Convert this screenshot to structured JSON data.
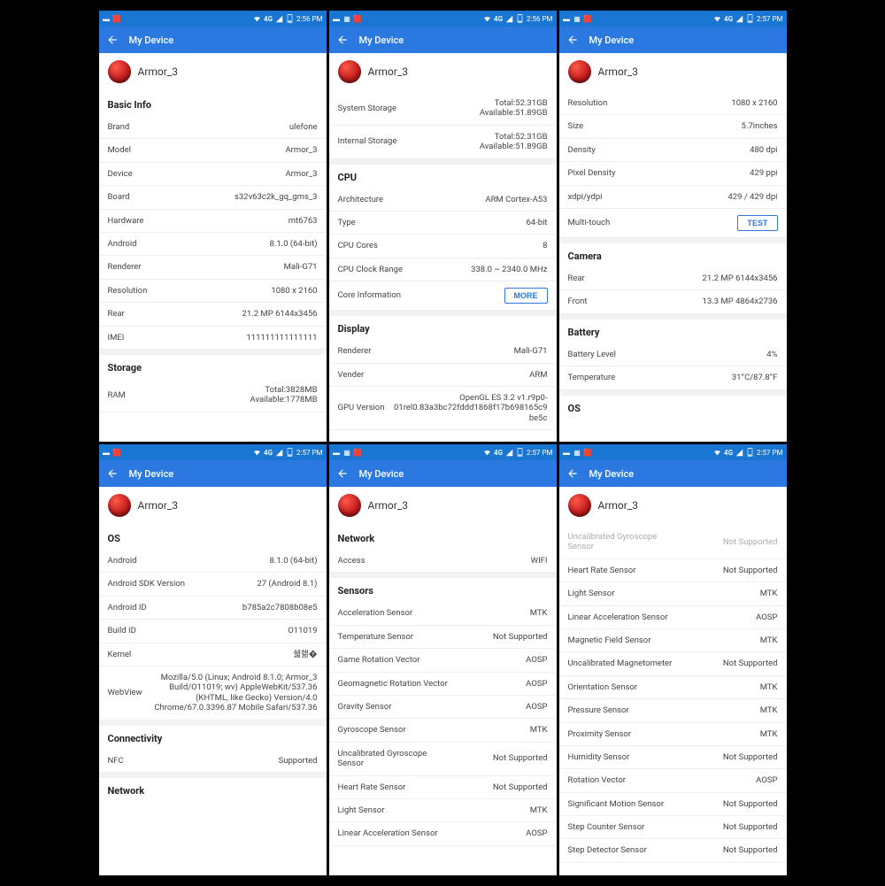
{
  "appbar_title": "My Device",
  "device_name": "Armor_3",
  "screens": [
    {
      "time": "2:56 PM",
      "groups": [
        {
          "title": "Basic Info",
          "rows": [
            {
              "label": "Brand",
              "value": "ulefone"
            },
            {
              "label": "Model",
              "value": "Armor_3"
            },
            {
              "label": "Device",
              "value": "Armor_3"
            },
            {
              "label": "Board",
              "value": "s32v63c2k_gq_gms_3"
            },
            {
              "label": "Hardware",
              "value": "mt6763"
            },
            {
              "label": "Android",
              "value": "8.1.0 (64-bit)"
            },
            {
              "label": "Renderer",
              "value": "Mali-G71"
            },
            {
              "label": "Resolution",
              "value": "1080 x 2160"
            },
            {
              "label": "Rear",
              "value": "21.2 MP 6144x3456"
            },
            {
              "label": "IMEI",
              "value": "111111111111111"
            }
          ]
        },
        {
          "title": "Storage",
          "rows": [
            {
              "label": "RAM",
              "value": "Total:3828MB\nAvailable:1778MB"
            }
          ]
        }
      ]
    },
    {
      "time": "2:56 PM",
      "pre_rows": [
        {
          "label": "System Storage",
          "value": "Total:52.31GB\nAvailable:51.89GB"
        },
        {
          "label": "Internal Storage",
          "value": "Total:52.31GB\nAvailable:51.89GB"
        }
      ],
      "groups": [
        {
          "title": "CPU",
          "rows": [
            {
              "label": "Architecture",
              "value": "ARM Cortex-A53"
            },
            {
              "label": "Type",
              "value": "64-bit"
            },
            {
              "label": "CPU Cores",
              "value": "8"
            },
            {
              "label": "CPU Clock Range",
              "value": "338.0 ~ 2340.0 MHz"
            },
            {
              "label": "Core Information",
              "button": "MORE"
            }
          ]
        },
        {
          "title": "Display",
          "rows": [
            {
              "label": "Renderer",
              "value": "Mali-G71"
            },
            {
              "label": "Vender",
              "value": "ARM"
            },
            {
              "label": "GPU Version",
              "value": "OpenGL ES 3.2 v1.r9p0-01rel0.83a3bc72fddd1868f17b698165c9be5c"
            }
          ]
        }
      ]
    },
    {
      "time": "2:57 PM",
      "pre_rows": [
        {
          "label": "Resolution",
          "value": "1080 x 2160"
        },
        {
          "label": "Size",
          "value": "5.7inches"
        },
        {
          "label": "Density",
          "value": "480 dpi"
        },
        {
          "label": "Pixel Density",
          "value": "429 ppi"
        },
        {
          "label": "xdpi/ydpi",
          "value": "429 / 429 dpi"
        },
        {
          "label": "Multi-touch",
          "button": "TEST"
        }
      ],
      "groups": [
        {
          "title": "Camera",
          "rows": [
            {
              "label": "Rear",
              "value": "21.2 MP 6144x3456"
            },
            {
              "label": "Front",
              "value": "13.3 MP 4864x2736"
            }
          ]
        },
        {
          "title": "Battery",
          "rows": [
            {
              "label": "Battery Level",
              "value": "4%"
            },
            {
              "label": "Temperature",
              "value": "31°C/87.8°F"
            }
          ]
        },
        {
          "title": "OS",
          "rows": []
        }
      ]
    },
    {
      "time": "2:57 PM",
      "groups": [
        {
          "title": "OS",
          "rows": [
            {
              "label": "Android",
              "value": "8.1.0 (64-bit)"
            },
            {
              "label": "Android SDK Version",
              "value": "27 (Android 8.1)"
            },
            {
              "label": "Android ID",
              "value": "b785a2c7808b08e5"
            },
            {
              "label": "Build ID",
              "value": "O11019"
            },
            {
              "label": "Kernel",
              "value": "쉛핾�"
            },
            {
              "label": "WebView",
              "value": "Mozilla/5.0 (Linux; Android 8.1.0; Armor_3 Build/O11019; wv) AppleWebKit/537.36 (KHTML, like Gecko) Version/4.0 Chrome/67.0.3396.87 Mobile Safari/537.36"
            }
          ]
        },
        {
          "title": "Connectivity",
          "rows": [
            {
              "label": "NFC",
              "value": "Supported"
            }
          ]
        },
        {
          "title": "Network",
          "rows": []
        }
      ]
    },
    {
      "time": "2:57 PM",
      "pre_section": "Network",
      "pre_rows_after_title": [
        {
          "label": "Access",
          "value": "WIFI"
        }
      ],
      "groups": [
        {
          "title": "Sensors",
          "rows": [
            {
              "label": "Acceleration Sensor",
              "value": "MTK"
            },
            {
              "label": "Temperature Sensor",
              "value": "Not Supported"
            },
            {
              "label": "Game Rotation Vector",
              "value": "AOSP"
            },
            {
              "label": "Geomagnetic Rotation Vector",
              "value": "AOSP"
            },
            {
              "label": "Gravity Sensor",
              "value": "AOSP"
            },
            {
              "label": "Gyroscope Sensor",
              "value": "MTK"
            },
            {
              "label": "Uncalibrated Gyroscope Sensor",
              "value": "Not Supported"
            },
            {
              "label": "Heart Rate Sensor",
              "value": "Not Supported"
            },
            {
              "label": "Light Sensor",
              "value": "MTK"
            },
            {
              "label": "Linear Acceleration Sensor",
              "value": "AOSP"
            }
          ]
        }
      ]
    },
    {
      "time": "2:57 PM",
      "pre_rows": [
        {
          "label": "Uncalibrated Gyroscope Sensor",
          "value": "Not Supported",
          "faded": true
        },
        {
          "label": "Heart Rate Sensor",
          "value": "Not Supported"
        },
        {
          "label": "Light Sensor",
          "value": "MTK"
        },
        {
          "label": "Linear Acceleration Sensor",
          "value": "AOSP"
        },
        {
          "label": "Magnetic Field Sensor",
          "value": "MTK"
        },
        {
          "label": "Uncalibrated Magnetometer",
          "value": "Not Supported"
        },
        {
          "label": "Orientation Sensor",
          "value": "MTK"
        },
        {
          "label": "Pressure Sensor",
          "value": "MTK"
        },
        {
          "label": "Proximity Sensor",
          "value": "MTK"
        },
        {
          "label": "Humidity Sensor",
          "value": "Not Supported"
        },
        {
          "label": "Rotation Vector",
          "value": "AOSP"
        },
        {
          "label": "Significant Motion Sensor",
          "value": "Not Supported"
        },
        {
          "label": "Step Counter Sensor",
          "value": "Not Supported"
        },
        {
          "label": "Step Detector Sensor",
          "value": "Not Supported"
        }
      ],
      "groups": []
    }
  ],
  "network_label": "4G",
  "sb_icons_left": [
    "message-icon",
    "app-icon",
    "image-icon"
  ],
  "sb_icons_right": [
    "wifi-icon",
    "signal-icon",
    "battery-icon"
  ]
}
